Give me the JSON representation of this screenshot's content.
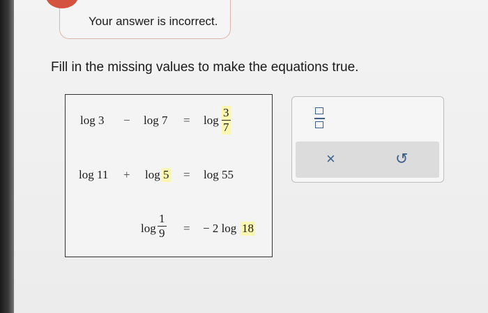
{
  "feedback": {
    "message": "Your answer is incorrect."
  },
  "instruction": "Fill in the missing values to make the equations true.",
  "equations": {
    "eq1": {
      "left": "log 3",
      "op": "−",
      "middle": "log 7",
      "equals": "=",
      "right_prefix": "log",
      "right_num": "3",
      "right_den": "7"
    },
    "eq2": {
      "left": "log 11",
      "op": "+",
      "middle_prefix": "log",
      "middle_value": "5",
      "equals": "=",
      "right": "log 55"
    },
    "eq3": {
      "left_prefix": "log",
      "left_num": "1",
      "left_den": "9",
      "equals": "=",
      "right_prefix": "− 2 log",
      "right_value": "18"
    }
  },
  "tools": {
    "fraction_icon": "fraction-template-icon",
    "clear_label": "×",
    "undo_label": "↺"
  },
  "colors": {
    "alert": "#d4533f",
    "answer_highlight": "#fbf6b0",
    "tool_icon": "#3a5f8c"
  }
}
